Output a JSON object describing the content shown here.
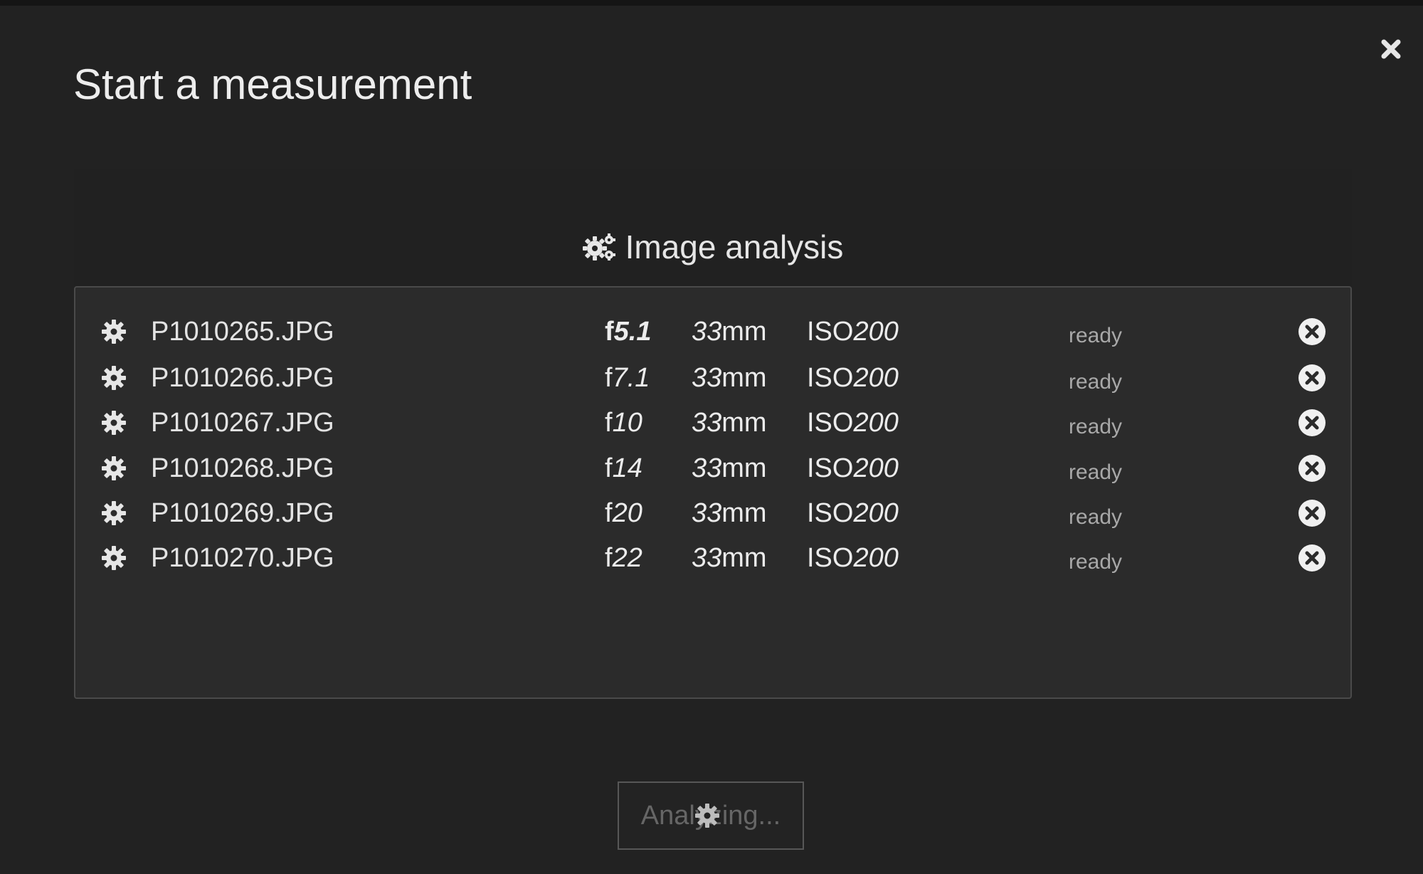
{
  "dialog": {
    "title": "Start a measurement",
    "close_icon": "close-x-icon"
  },
  "section": {
    "title": "Image analysis",
    "icon": "gears-icon"
  },
  "files": [
    {
      "name": "P1010265.JPG",
      "aperture_prefix": "f",
      "aperture": "5.1",
      "focal": "33",
      "focal_unit": "mm",
      "iso_prefix": "ISO",
      "iso": "200",
      "status": "ready"
    },
    {
      "name": "P1010266.JPG",
      "aperture_prefix": "f",
      "aperture": "7.1",
      "focal": "33",
      "focal_unit": "mm",
      "iso_prefix": "ISO",
      "iso": "200",
      "status": "ready"
    },
    {
      "name": "P1010267.JPG",
      "aperture_prefix": "f",
      "aperture": "10",
      "focal": "33",
      "focal_unit": "mm",
      "iso_prefix": "ISO",
      "iso": "200",
      "status": "ready"
    },
    {
      "name": "P1010268.JPG",
      "aperture_prefix": "f",
      "aperture": "14",
      "focal": "33",
      "focal_unit": "mm",
      "iso_prefix": "ISO",
      "iso": "200",
      "status": "ready"
    },
    {
      "name": "P1010269.JPG",
      "aperture_prefix": "f",
      "aperture": "20",
      "focal": "33",
      "focal_unit": "mm",
      "iso_prefix": "ISO",
      "iso": "200",
      "status": "ready"
    },
    {
      "name": "P1010270.JPG",
      "aperture_prefix": "f",
      "aperture": "22",
      "focal": "33",
      "focal_unit": "mm",
      "iso_prefix": "ISO",
      "iso": "200",
      "status": "ready"
    }
  ],
  "action": {
    "label": "Analyzing...",
    "disabled": true,
    "spinner_icon": "gear-spinner-icon"
  },
  "colors": {
    "background": "#222222",
    "panel": "#2b2b2b",
    "text": "#e8e8e8",
    "muted": "#a8a8a8"
  }
}
